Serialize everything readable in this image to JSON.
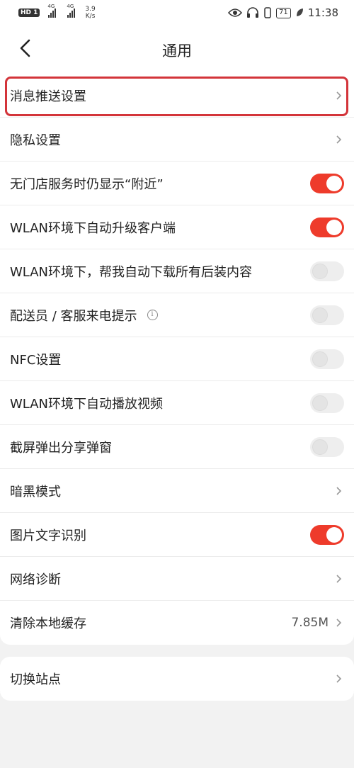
{
  "statusbar": {
    "hd": "HD",
    "sim1": "1",
    "net1": "4G",
    "net2": "4G",
    "speed_value": "3.9",
    "speed_unit": "K/s",
    "battery": "71",
    "time": "11:38"
  },
  "header": {
    "title": "通用"
  },
  "settings": {
    "rows": [
      {
        "label": "消息推送设置",
        "type": "chevron"
      },
      {
        "label": "隐私设置",
        "type": "chevron"
      },
      {
        "label": "无门店服务时仍显示“附近”",
        "type": "toggle",
        "on": true
      },
      {
        "label": "WLAN环境下自动升级客户端",
        "type": "toggle",
        "on": true
      },
      {
        "label": "WLAN环境下，帮我自动下载所有后装内容",
        "type": "toggle",
        "on": false
      },
      {
        "label": "配送员 / 客服来电提示",
        "type": "toggle",
        "on": false
      },
      {
        "label": "NFC设置",
        "type": "toggle",
        "on": false
      },
      {
        "label": "WLAN环境下自动播放视频",
        "type": "toggle",
        "on": false
      },
      {
        "label": "截屏弹出分享弹窗",
        "type": "toggle",
        "on": false
      },
      {
        "label": "暗黑模式",
        "type": "chevron"
      },
      {
        "label": "图片文字识别",
        "type": "toggle",
        "on": true
      },
      {
        "label": "网络诊断",
        "type": "chevron"
      },
      {
        "label": "清除本地缓存",
        "type": "chevron",
        "value": "7.85M"
      }
    ],
    "info_icon": "i"
  },
  "site": {
    "label": "切换站点"
  },
  "colors": {
    "accent": "#ee3b2b",
    "highlight": "#d3343a"
  }
}
